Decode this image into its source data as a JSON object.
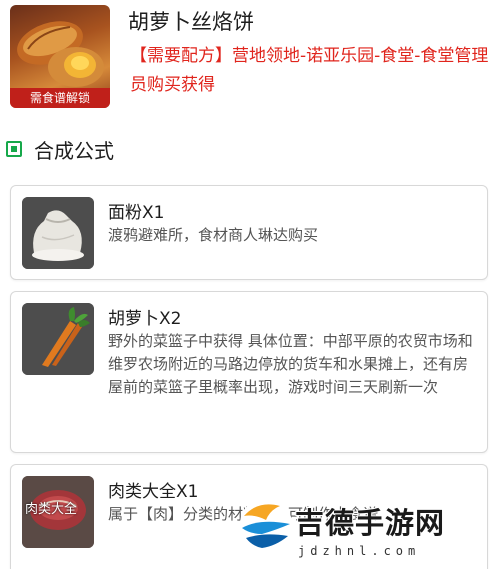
{
  "dish": {
    "name": "胡萝卜丝烙饼",
    "lock_label": "需食谱解锁",
    "recipe_source": "【需要配方】营地领地-诺亚乐园-食堂-食堂管理员购买获得"
  },
  "section": {
    "title": "合成公式"
  },
  "ingredients": [
    {
      "name": "面粉X1",
      "desc": "渡鸦避难所，食材商人琳达购买",
      "icon": "flour-sack-icon"
    },
    {
      "name": "胡萝卜X2",
      "desc": "野外的菜篮子中获得 具体位置：中部平原的农贸市场和维罗农场附近的马路边停放的货车和水果摊上，还有房屋前的菜篮子里概率出现，游戏时间三天刷新一次",
      "icon": "carrot-icon"
    },
    {
      "name": "肉类大全X1",
      "desc": "属于【肉】分类的材料，均可制作本食谱",
      "icon": "meat-icon",
      "icon_label": "肉类大全"
    }
  ],
  "watermark": {
    "text": "吉德手游网",
    "url": "jdzhnl.com"
  },
  "colors": {
    "accent_red": "#e0251d",
    "section_green": "#16a84a"
  }
}
